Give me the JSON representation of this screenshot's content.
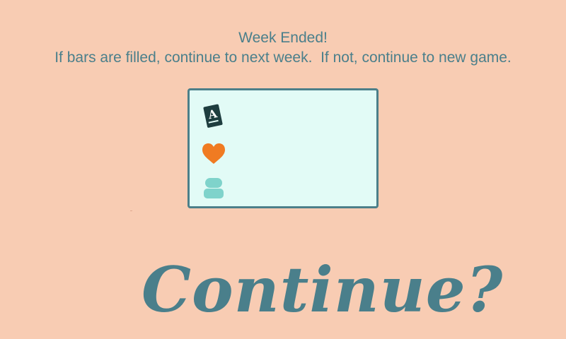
{
  "message": {
    "line1": "Week Ended!",
    "line2": "If bars are filled, continue to next week.  If not, continue to new game."
  },
  "stats": [
    {
      "icon": "study-book-icon",
      "glyph": "A",
      "level": 0,
      "color": "#1e3d3f"
    },
    {
      "icon": "heart-icon",
      "level": 0,
      "color": "#f07b22"
    },
    {
      "icon": "friend-icon",
      "level": 0,
      "color": "#7fd3cb"
    }
  ],
  "continue_label": "Continue?",
  "colors": {
    "background": "#f8ccb3",
    "text": "#4a7f8b",
    "panel_fill": "#e2fbf6",
    "panel_border": "#4c7f89"
  }
}
